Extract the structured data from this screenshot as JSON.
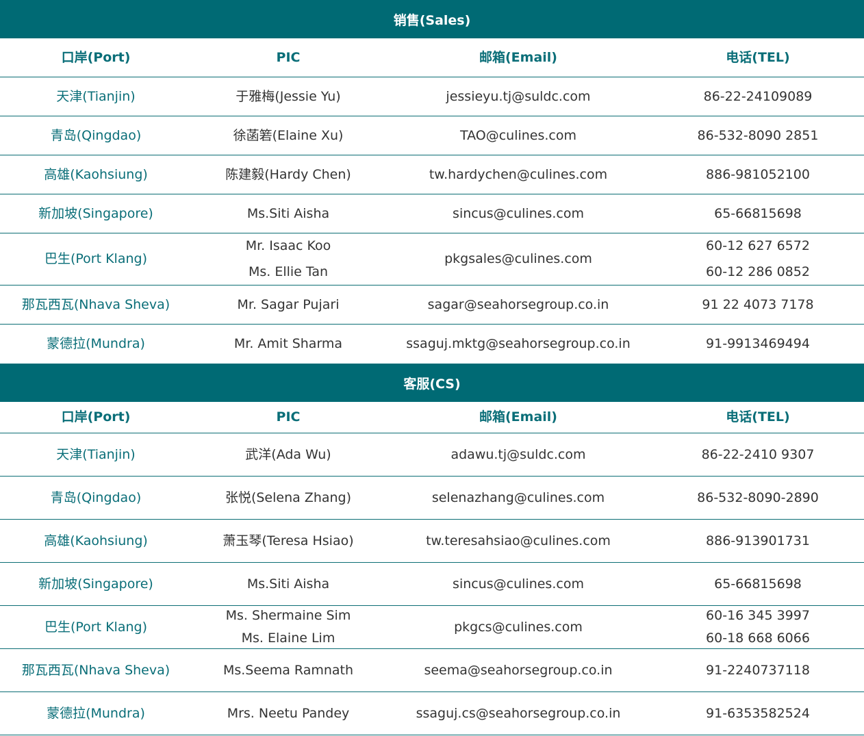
{
  "sales": {
    "title": "销售(Sales)",
    "headers": [
      "口岸(Port)",
      "PIC",
      "邮箱(Email)",
      "电话(TEL)"
    ],
    "rows": [
      {
        "port": "天津(Tianjin)",
        "pic": [
          "于雅梅(Jessie Yu)"
        ],
        "email": "jessieyu.tj@suldc.com",
        "tel": [
          "86-22-24109089"
        ]
      },
      {
        "port": "青岛(Qingdao)",
        "pic": [
          "徐菡箬(Elaine Xu)"
        ],
        "email": "TAO@culines.com",
        "tel": [
          "86-532-8090 2851"
        ]
      },
      {
        "port": "高雄(Kaohsiung)",
        "pic": [
          "陈建毅(Hardy Chen)"
        ],
        "email": "tw.hardychen@culines.com",
        "tel": [
          "886-981052100"
        ]
      },
      {
        "port": "新加坡(Singapore)",
        "pic": [
          "Ms.Siti Aisha"
        ],
        "email": "sincus@culines.com",
        "tel": [
          "65-66815698"
        ]
      },
      {
        "port": "巴生(Port Klang)",
        "pic": [
          "Mr. Isaac Koo",
          "Ms. Ellie Tan"
        ],
        "email": "pkgsales@culines.com",
        "tel": [
          "60-12 627 6572",
          "60-12 286 0852"
        ]
      },
      {
        "port": "那瓦西瓦(Nhava Sheva)",
        "pic": [
          "Mr. Sagar Pujari"
        ],
        "email": "sagar@seahorsegroup.co.in",
        "tel": [
          "91 22 4073 7178"
        ]
      },
      {
        "port": "蒙德拉(Mundra)",
        "pic": [
          "Mr. Amit Sharma"
        ],
        "email": "ssaguj.mktg@seahorsegroup.co.in",
        "tel": [
          "91-9913469494"
        ]
      }
    ]
  },
  "cs": {
    "title": "客服(CS)",
    "headers": [
      "口岸(Port)",
      "PIC",
      "邮箱(Email)",
      "电话(TEL)"
    ],
    "rows": [
      {
        "port": "天津(Tianjin)",
        "pic": [
          "武洋(Ada Wu)"
        ],
        "email": "adawu.tj@suldc.com",
        "tel": [
          "86-22-2410 9307"
        ]
      },
      {
        "port": "青岛(Qingdao)",
        "pic": [
          "张悦(Selena Zhang)"
        ],
        "email": "selenazhang@culines.com",
        "tel": [
          "86-532-8090-2890"
        ]
      },
      {
        "port": "高雄(Kaohsiung)",
        "pic": [
          "萧玉琴(Teresa Hsiao)"
        ],
        "email": "tw.teresahsiao@culines.com",
        "tel": [
          "886-913901731"
        ]
      },
      {
        "port": "新加坡(Singapore)",
        "pic": [
          "Ms.Siti Aisha"
        ],
        "email": "sincus@culines.com",
        "tel": [
          "65-66815698"
        ]
      },
      {
        "port": "巴生(Port Klang)",
        "pic": [
          "Ms. Shermaine Sim",
          "Ms. Elaine Lim"
        ],
        "email": "pkgcs@culines.com",
        "tel": [
          "60-16 345 3997",
          "60-18 668 6066"
        ]
      },
      {
        "port": "那瓦西瓦(Nhava Sheva)",
        "pic": [
          "Ms.Seema Ramnath"
        ],
        "email": "seema@seahorsegroup.co.in",
        "tel": [
          "91-2240737118"
        ]
      },
      {
        "port": "蒙德拉(Mundra)",
        "pic": [
          "Mrs. Neetu Pandey"
        ],
        "email": "ssaguj.cs@seahorsegroup.co.in",
        "tel": [
          "91-6353582524"
        ]
      }
    ]
  }
}
